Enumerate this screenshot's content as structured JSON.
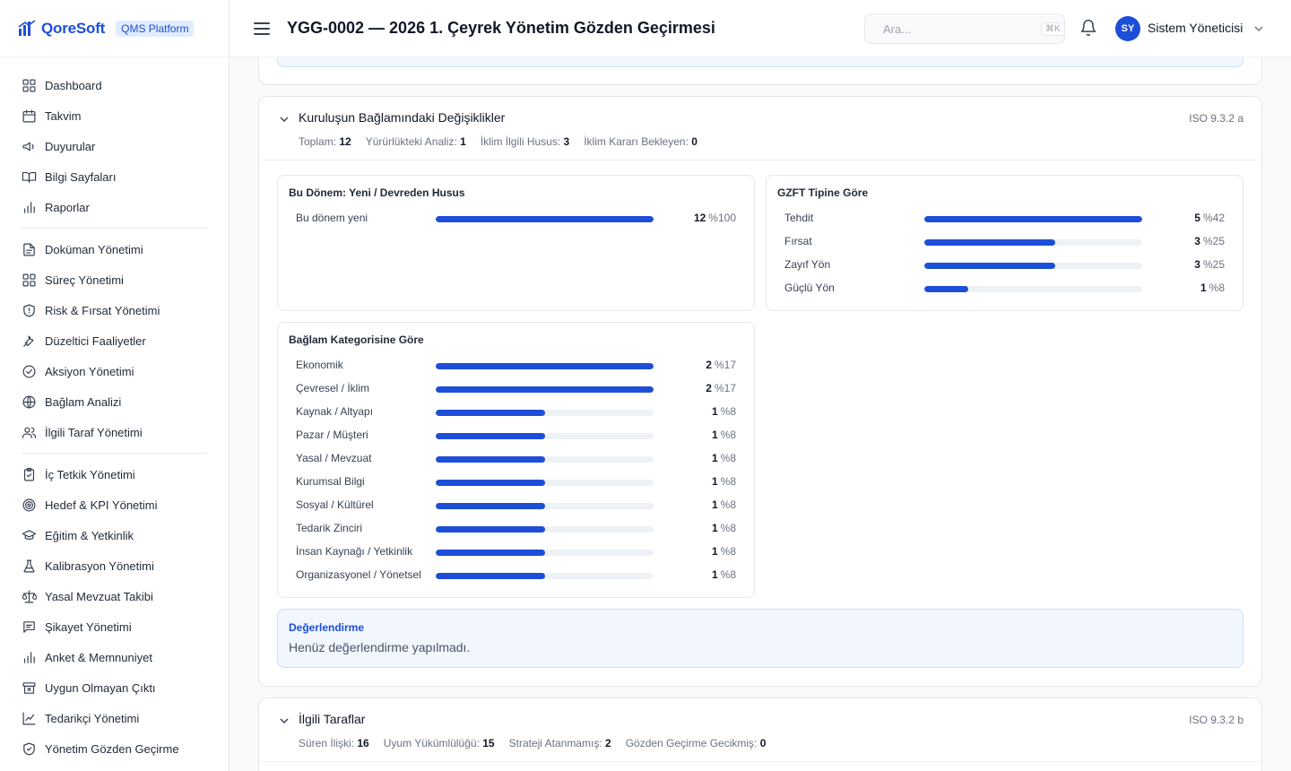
{
  "brand": {
    "logo_text": "QoreSoft",
    "platform_badge": "QMS Platform",
    "accent": "#1d4ed8"
  },
  "sidebar": {
    "groups": [
      [
        {
          "label": "Dashboard",
          "icon": "grid-icon"
        },
        {
          "label": "Takvim",
          "icon": "calendar-icon"
        },
        {
          "label": "Duyurular",
          "icon": "megaphone-icon"
        },
        {
          "label": "Bilgi Sayfaları",
          "icon": "book-icon"
        },
        {
          "label": "Raporlar",
          "icon": "bar-chart-icon"
        }
      ],
      [
        {
          "label": "Doküman Yönetimi",
          "icon": "document-icon"
        },
        {
          "label": "Süreç Yönetimi",
          "icon": "grid-icon"
        },
        {
          "label": "Risk & Fırsat Yönetimi",
          "icon": "shield-icon"
        },
        {
          "label": "Düzeltici Faaliyetler",
          "icon": "wrench-icon"
        },
        {
          "label": "Aksiyon Yönetimi",
          "icon": "check-circle-icon"
        },
        {
          "label": "Bağlam Analizi",
          "icon": "globe-icon"
        },
        {
          "label": "İlgili Taraf Yönetimi",
          "icon": "users-icon"
        }
      ],
      [
        {
          "label": "İç Tetkik Yönetimi",
          "icon": "clipboard-check-icon"
        },
        {
          "label": "Hedef & KPI Yönetimi",
          "icon": "target-icon"
        },
        {
          "label": "Eğitim & Yetkinlik",
          "icon": "graduation-cap-icon"
        },
        {
          "label": "Kalibrasyon Yönetimi",
          "icon": "flask-icon"
        },
        {
          "label": "Yasal Mevzuat Takibi",
          "icon": "scale-icon"
        },
        {
          "label": "Şikayet Yönetimi",
          "icon": "message-icon"
        },
        {
          "label": "Anket & Memnuniyet",
          "icon": "bar-chart-icon"
        },
        {
          "label": "Uygun Olmayan Çıktı",
          "icon": "archive-x-icon"
        },
        {
          "label": "Tedarikçi Yönetimi",
          "icon": "line-chart-icon"
        },
        {
          "label": "Yönetim Gözden Geçirme",
          "icon": "shield-check-icon"
        }
      ]
    ]
  },
  "header": {
    "title": "YGG-0002 — 2026 1. Çeyrek Yönetim Gözden Geçirmesi",
    "search_placeholder": "Ara...",
    "search_shortcut": "⌘K",
    "user_initials": "SY",
    "user_name": "Sistem Yöneticisi"
  },
  "section_context": {
    "title": "Kuruluşun Bağlamındaki Değişiklikler",
    "iso_ref": "ISO 9.3.2 a",
    "stats": [
      {
        "label": "Toplam:",
        "value": "12"
      },
      {
        "label": "Yürürlükteki Analiz:",
        "value": "1"
      },
      {
        "label": "İklim İlgili Husus:",
        "value": "3"
      },
      {
        "label": "İklim Kararı Bekleyen:",
        "value": "0"
      }
    ],
    "panel_new": {
      "title": "Bu Dönem: Yeni / Devreden Husus",
      "rows": [
        {
          "label": "Bu dönem yeni",
          "count": "12",
          "pct": "%100",
          "fill": 1.0
        }
      ]
    },
    "panel_swot": {
      "title": "GZFT Tipine Göre",
      "rows": [
        {
          "label": "Tehdit",
          "count": "5",
          "pct": "%42",
          "fill": 1.0
        },
        {
          "label": "Fırsat",
          "count": "3",
          "pct": "%25",
          "fill": 0.6
        },
        {
          "label": "Zayıf Yön",
          "count": "3",
          "pct": "%25",
          "fill": 0.6
        },
        {
          "label": "Güçlü Yön",
          "count": "1",
          "pct": "%8",
          "fill": 0.2
        }
      ]
    },
    "panel_category": {
      "title": "Bağlam Kategorisine Göre",
      "rows": [
        {
          "label": "Ekonomik",
          "count": "2",
          "pct": "%17",
          "fill": 1.0
        },
        {
          "label": "Çevresel / İklim",
          "count": "2",
          "pct": "%17",
          "fill": 1.0
        },
        {
          "label": "Kaynak / Altyapı",
          "count": "1",
          "pct": "%8",
          "fill": 0.5
        },
        {
          "label": "Pazar / Müşteri",
          "count": "1",
          "pct": "%8",
          "fill": 0.5
        },
        {
          "label": "Yasal / Mevzuat",
          "count": "1",
          "pct": "%8",
          "fill": 0.5
        },
        {
          "label": "Kurumsal Bilgi",
          "count": "1",
          "pct": "%8",
          "fill": 0.5
        },
        {
          "label": "Sosyal / Kültürel",
          "count": "1",
          "pct": "%8",
          "fill": 0.5
        },
        {
          "label": "Tedarik Zinciri",
          "count": "1",
          "pct": "%8",
          "fill": 0.5
        },
        {
          "label": "İnsan Kaynağı / Yetkinlik",
          "count": "1",
          "pct": "%8",
          "fill": 0.5
        },
        {
          "label": "Organizasyonel / Yönetsel",
          "count": "1",
          "pct": "%8",
          "fill": 0.5
        }
      ]
    },
    "evaluation": {
      "title": "Değerlendirme",
      "text": "Henüz değerlendirme yapılmadı."
    }
  },
  "section_parties": {
    "title": "İlgili Taraflar",
    "iso_ref": "ISO 9.3.2 b",
    "stats": [
      {
        "label": "Süren İlişki:",
        "value": "16"
      },
      {
        "label": "Uyum Yükümlülüğü:",
        "value": "15"
      },
      {
        "label": "Strateji Atanmamış:",
        "value": "2"
      },
      {
        "label": "Gözden Geçirme Gecikmiş:",
        "value": "0"
      }
    ]
  }
}
